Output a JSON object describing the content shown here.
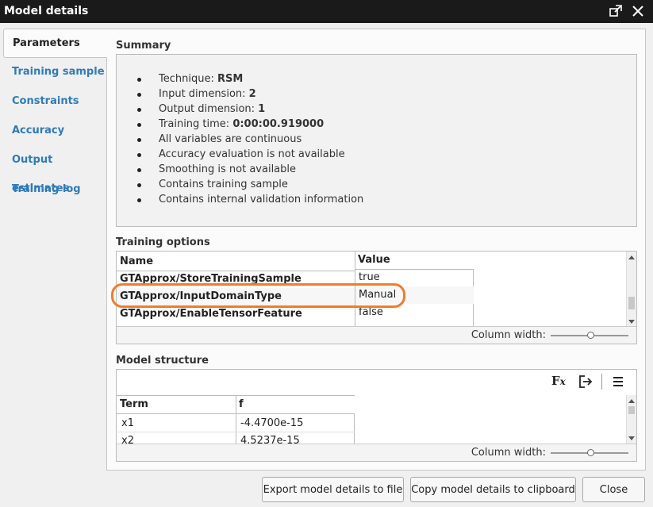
{
  "window": {
    "title": "Model details"
  },
  "sidebar": {
    "items": [
      {
        "label": "Parameters"
      },
      {
        "label": "Training sample"
      },
      {
        "label": "Constraints"
      },
      {
        "label": "Accuracy"
      },
      {
        "label": "Output estimates"
      },
      {
        "label": "Training log"
      }
    ]
  },
  "summary": {
    "title": "Summary",
    "items": [
      {
        "prefix": "Technique: ",
        "value": "RSM"
      },
      {
        "prefix": "Input dimension: ",
        "value": "2"
      },
      {
        "prefix": "Output dimension: ",
        "value": "1"
      },
      {
        "prefix": "Training time: ",
        "value": "0:00:00.919000"
      },
      {
        "prefix": "All variables are continuous",
        "value": ""
      },
      {
        "prefix": "Accuracy evaluation is not available",
        "value": ""
      },
      {
        "prefix": "Smoothing is not available",
        "value": ""
      },
      {
        "prefix": "Contains training sample",
        "value": ""
      },
      {
        "prefix": "Contains internal validation information",
        "value": ""
      }
    ]
  },
  "training_options": {
    "title": "Training options",
    "columns": [
      "Name",
      "Value"
    ],
    "rows": [
      {
        "name": "GTApprox/StoreTrainingSample",
        "value": "true"
      },
      {
        "name": "GTApprox/InputDomainType",
        "value": "Manual"
      },
      {
        "name": "GTApprox/EnableTensorFeature",
        "value": "false"
      }
    ],
    "column_width_label": "Column width:"
  },
  "model_structure": {
    "title": "Model structure",
    "columns": [
      "Term",
      "f"
    ],
    "rows": [
      {
        "term": "x1",
        "f": "-4.4700e-15"
      },
      {
        "term": "x2",
        "f": "4.5237e-15"
      }
    ],
    "column_width_label": "Column width:"
  },
  "buttons": {
    "export": "Export model details to file",
    "copy": "Copy model details to clipboard",
    "close": "Close"
  },
  "colors": {
    "accent_link": "#2f7ab9",
    "highlight": "#f07d2a",
    "titlebar": "#1a1a1a"
  }
}
